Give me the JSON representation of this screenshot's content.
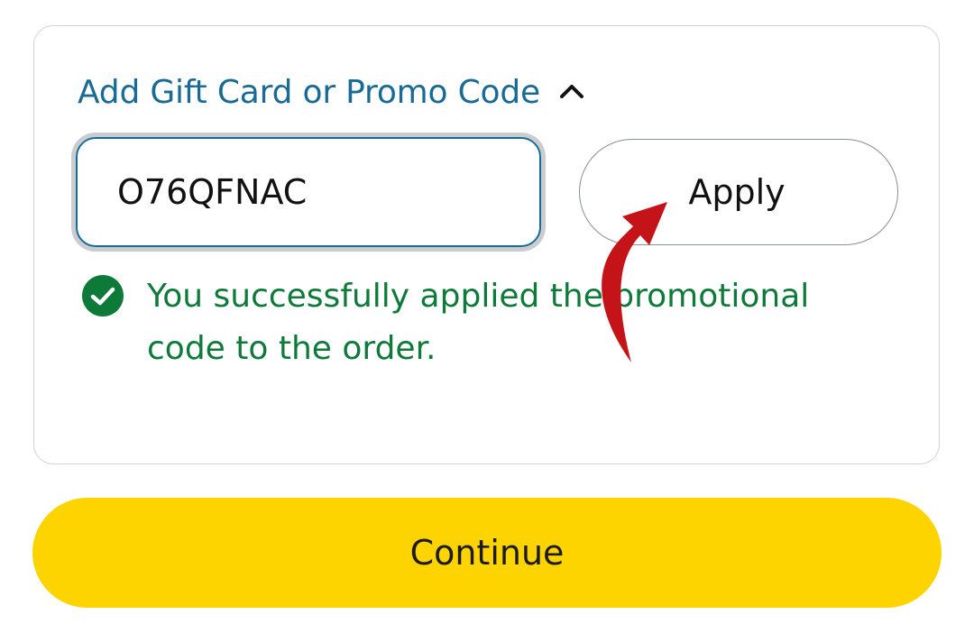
{
  "promo": {
    "toggle_label": "Add Gift Card or Promo Code",
    "toggle_icon": "chevron-up-icon",
    "code_value": "O76QFNAC",
    "apply_label": "Apply",
    "success_message": "You successfully applied the promotional code to the order.",
    "success_icon": "check-circle-icon"
  },
  "footer": {
    "continue_label": "Continue"
  },
  "colors": {
    "link_blue": "#1a6a96",
    "success_green": "#0e7a3a",
    "continue_yellow": "#fed400",
    "annotation_red": "#c4141a"
  }
}
